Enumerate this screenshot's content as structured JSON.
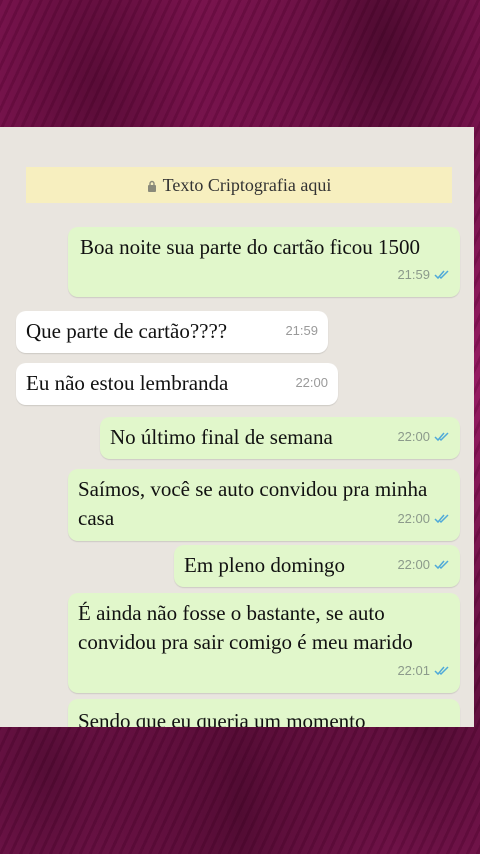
{
  "encryption_banner": {
    "text": "Texto Criptografia aqui",
    "icon": "lock-icon"
  },
  "colors": {
    "outgoing_bubble": "#e1f7cb",
    "incoming_bubble": "#ffffff",
    "chat_background": "#e9e5df",
    "banner": "#f7efbf",
    "read_ticks": "#4fa9d9",
    "frame": "#94145e"
  },
  "messages": [
    {
      "direction": "out",
      "text": "Boa noite sua parte do cartão ficou 1500",
      "time": "21:59",
      "status": "read"
    },
    {
      "direction": "in",
      "text": "Que parte de cartão????",
      "time": "21:59"
    },
    {
      "direction": "in",
      "text": "Eu não estou lembranda",
      "time": "22:00"
    },
    {
      "direction": "out",
      "text": "No último final de semana",
      "time": "22:00",
      "status": "read"
    },
    {
      "direction": "out",
      "text": "Saímos, você se auto convidou pra minha casa",
      "time": "22:00",
      "status": "read"
    },
    {
      "direction": "out",
      "text": "Em pleno domingo",
      "time": "22:00",
      "status": "read"
    },
    {
      "direction": "out",
      "text": "É ainda não fosse o bastante, se auto convidou pra sair comigo é meu marido",
      "time": "22:01",
      "status": "read"
    },
    {
      "direction": "out",
      "text": "Sendo que eu queria um momento",
      "time": "",
      "status": ""
    }
  ]
}
